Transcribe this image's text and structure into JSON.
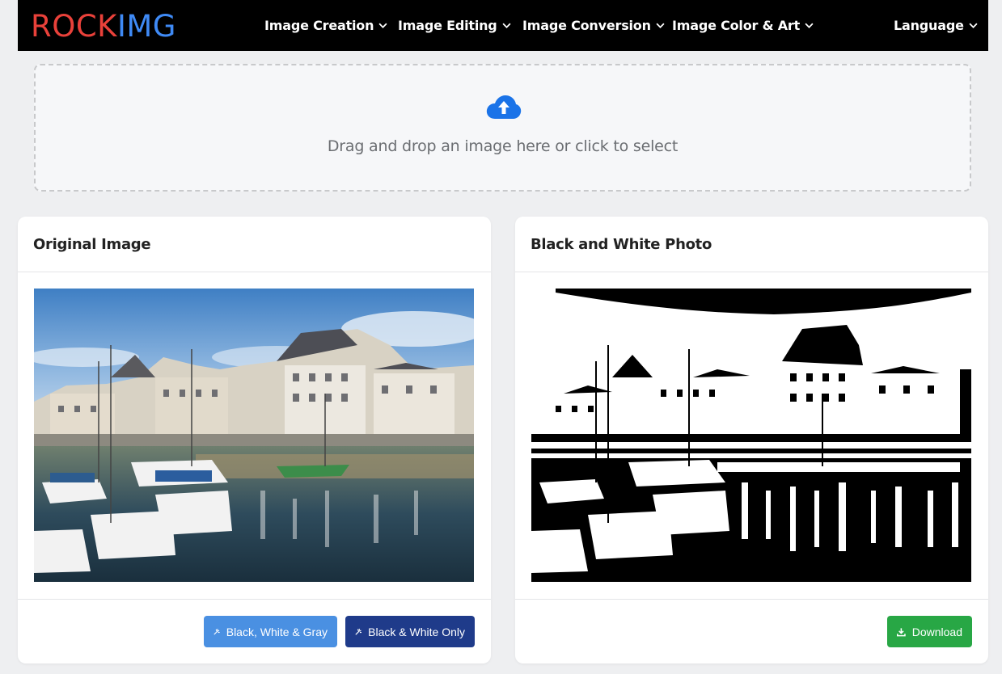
{
  "nav": {
    "logo_part1": "ROCK",
    "logo_part2": "IMG",
    "items": [
      {
        "label": "Image Creation"
      },
      {
        "label": "Image Editing"
      },
      {
        "label": "Image Conversion"
      },
      {
        "label": "Image Color & Art"
      }
    ],
    "language_label": "Language"
  },
  "upload": {
    "icon": "cloud-upload-icon",
    "text": "Drag and drop an image here or click to select"
  },
  "original_card": {
    "title": "Original Image",
    "buttons": {
      "gray_label": "Black, White & Gray",
      "bw_label": "Black & White Only"
    }
  },
  "result_card": {
    "title": "Black and White Photo",
    "download_label": "Download"
  },
  "colors": {
    "logo_red": "#e9413a",
    "logo_blue": "#3f8af5",
    "btn_gray": "#4a90e2",
    "btn_bw": "#1f3b8a",
    "btn_download": "#28a745",
    "upload_icon": "#1a73e8"
  }
}
